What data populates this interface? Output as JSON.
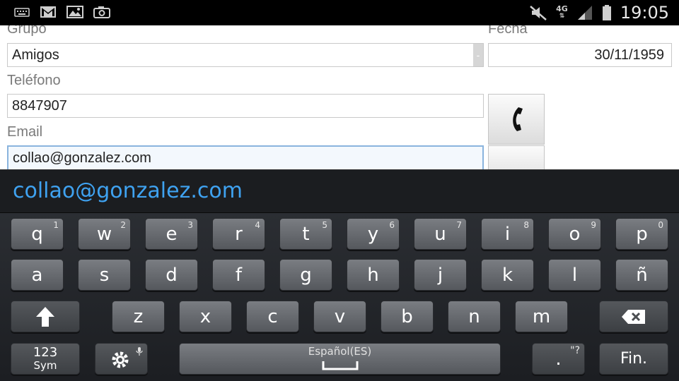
{
  "statusbar": {
    "time": "19:05",
    "network": "4G",
    "icons_left": [
      "keyboard-icon",
      "gmail-icon",
      "gallery-icon",
      "screenshot-icon"
    ],
    "icons_right": [
      "mute-icon",
      "network-4g-icon",
      "signal-icon",
      "battery-icon"
    ]
  },
  "form": {
    "grupo_label": "Grupo",
    "grupo_value": "Amigos",
    "dropdown_glyph": "-",
    "fecha_label": "Fecha",
    "fecha_value": "30/11/1959",
    "telefono_label": "Teléfono",
    "telefono_value": "8847907",
    "email_label": "Email",
    "email_value": "collao@gonzalez.com"
  },
  "suggestion": {
    "text": "collao@gonzalez.com",
    "color": "#3fa2f0"
  },
  "keyboard": {
    "row1": [
      {
        "ch": "q",
        "num": "1"
      },
      {
        "ch": "w",
        "num": "2"
      },
      {
        "ch": "e",
        "num": "3"
      },
      {
        "ch": "r",
        "num": "4"
      },
      {
        "ch": "t",
        "num": "5"
      },
      {
        "ch": "y",
        "num": "6"
      },
      {
        "ch": "u",
        "num": "7"
      },
      {
        "ch": "i",
        "num": "8"
      },
      {
        "ch": "o",
        "num": "9"
      },
      {
        "ch": "p",
        "num": "0"
      }
    ],
    "row2": [
      "a",
      "s",
      "d",
      "f",
      "g",
      "h",
      "j",
      "k",
      "l",
      "ñ"
    ],
    "row3": [
      "z",
      "x",
      "c",
      "v",
      "b",
      "n",
      "m"
    ],
    "sym_line1": "123",
    "sym_line2": "Sym",
    "space_label": "Español(ES)",
    "period": ".",
    "period_alt": "\"?",
    "enter_label": "Fin."
  }
}
